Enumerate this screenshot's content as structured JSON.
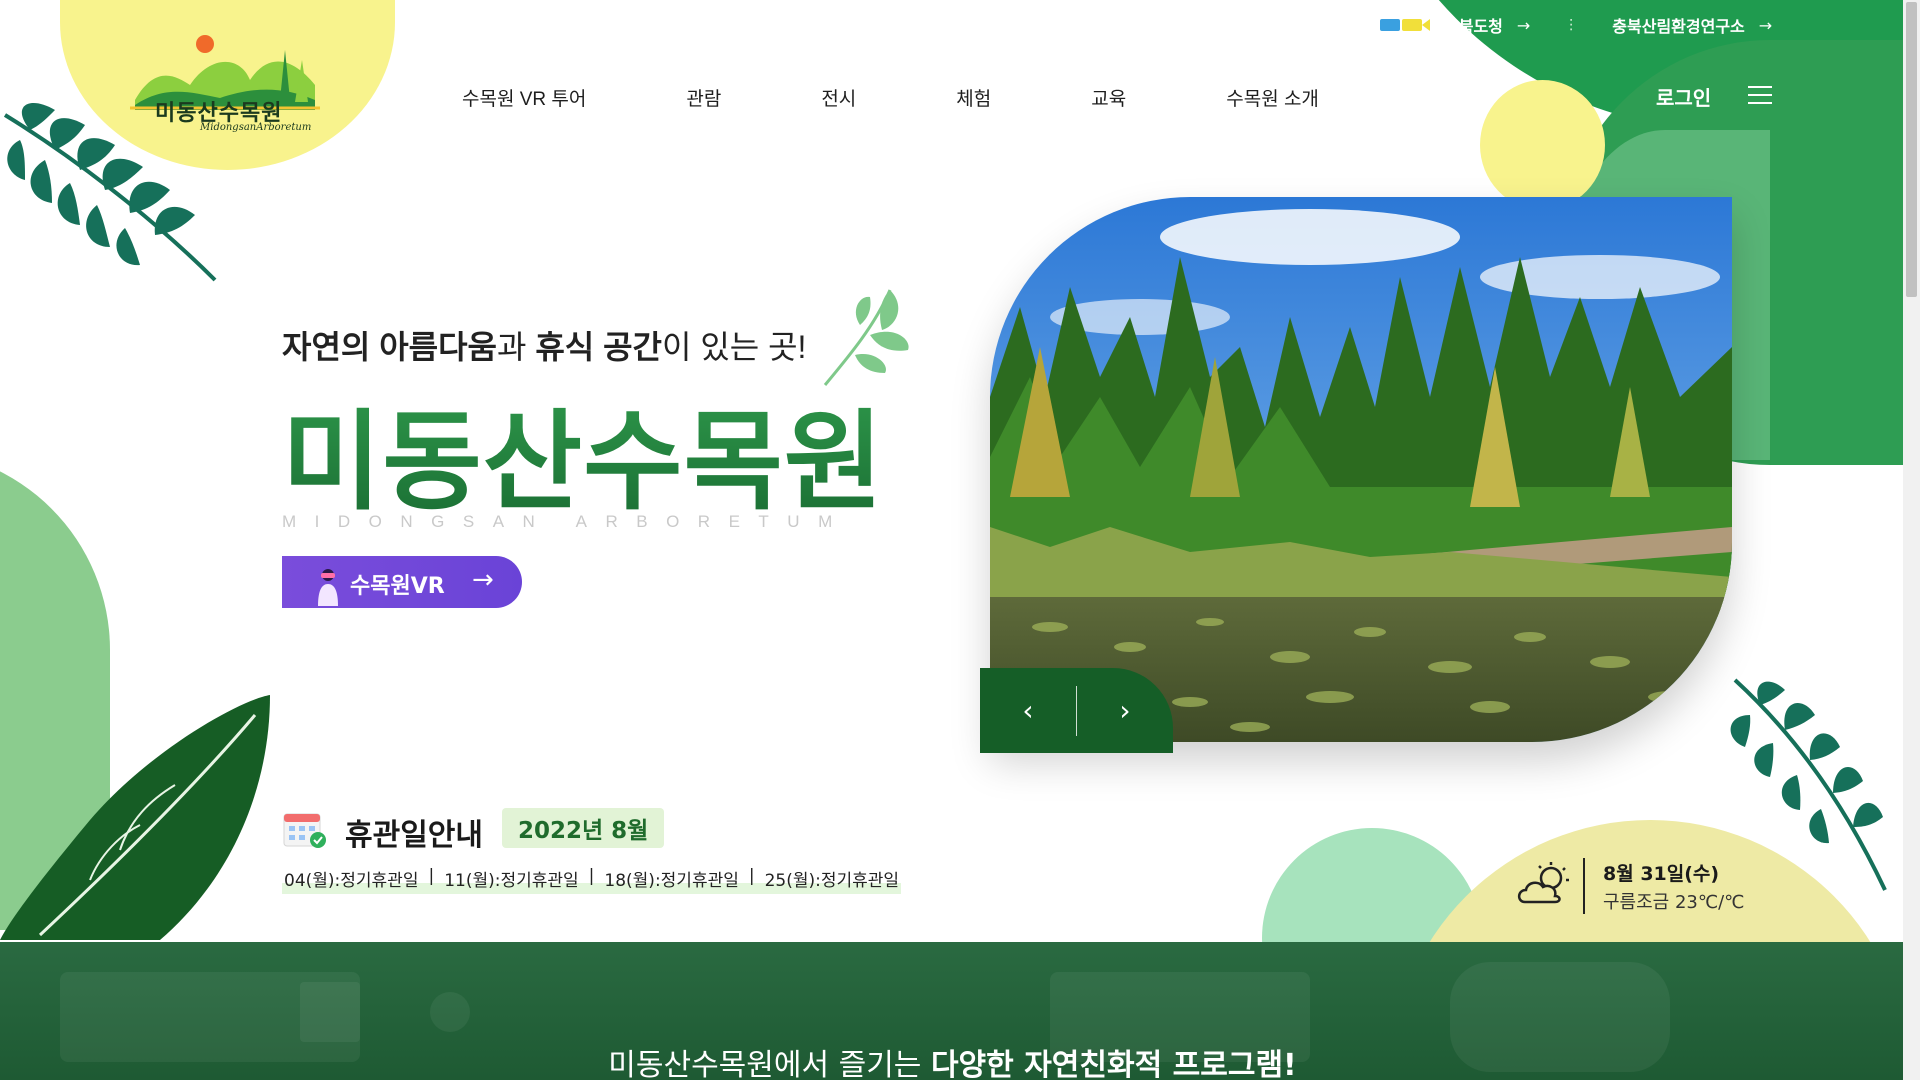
{
  "colors": {
    "brand_green": "#1f9b4f",
    "dark_green": "#155e27",
    "title_green": "#1d7a3a",
    "vr_purple": "#6a43d7",
    "yellow": "#f8f38d",
    "mint": "#a7e3bd",
    "highlight": "#e3f6dc"
  },
  "logo": {
    "title": "미동산수목원",
    "subtitle": "MidongsanArboretum"
  },
  "top_links": [
    {
      "label": "충북도청",
      "arrow": "→",
      "icon": "chungbuk-gov-logo-icon"
    },
    {
      "label": "충북산림환경연구소",
      "arrow": "→"
    }
  ],
  "top_link_sep": "⋮",
  "nav": [
    {
      "label": "수목원 VR 투어"
    },
    {
      "label": "관람"
    },
    {
      "label": "전시"
    },
    {
      "label": "체험"
    },
    {
      "label": "교육"
    },
    {
      "label": "수목원 소개"
    }
  ],
  "header": {
    "login": "로그인",
    "menu_icon": "hamburger-menu-icon"
  },
  "hero": {
    "tagline_parts": [
      "자연의 아름다움",
      "과 ",
      "휴식 공간",
      "이 있는 곳!"
    ],
    "title": "미동산수목원",
    "subtitle": "MIDONGSAN ARBORETUM",
    "vr_button": {
      "label": "수목원VR",
      "arrow": "→"
    },
    "photo_description_icon": "arboretum-pond-photo",
    "prev": "‹",
    "next": "›"
  },
  "closed_days": {
    "title": "휴관일안내",
    "month": "2022년 8월",
    "icon": "calendar-check-icon",
    "items": [
      "04(월):정기휴관일",
      "11(월):정기휴관일",
      "18(월):정기휴관일",
      "25(월):정기휴관일"
    ],
    "separator": "|"
  },
  "weather": {
    "icon": "partly-cloudy-icon",
    "date": "8월 31일(수)",
    "condition": "구름조금 23℃/℃"
  },
  "bottom_banner": {
    "text_normal": "미동산수목원에서 즐기는 ",
    "text_bold": "다양한 자연친화적 프로그램!"
  }
}
